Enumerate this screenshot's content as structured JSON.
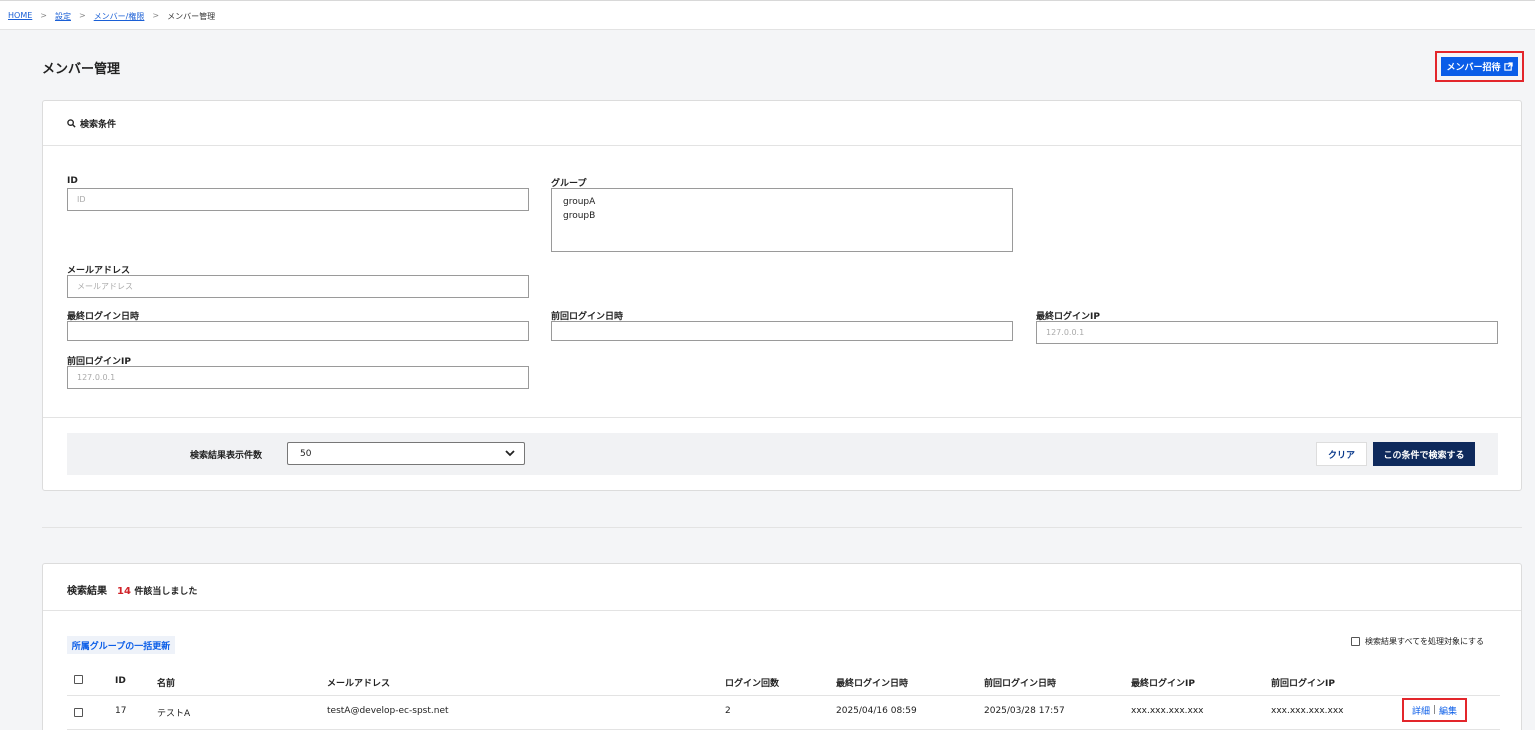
{
  "breadcrumb": {
    "home": "HOME",
    "settings": "設定",
    "members_perm": "メンバー/権限",
    "current": "メンバー管理",
    "sep": ">"
  },
  "page": {
    "title": "メンバー管理",
    "invite_button": "メンバー招待"
  },
  "search": {
    "title": "検索条件",
    "id_label": "ID",
    "id_placeholder": "ID",
    "group_label": "グループ",
    "group_options": [
      "groupA",
      "groupB"
    ],
    "email_label": "メールアドレス",
    "email_placeholder": "メールアドレス",
    "last_login_label": "最終ログイン日時",
    "prev_login_label": "前回ログイン日時",
    "last_ip_label": "最終ログインIP",
    "last_ip_placeholder": "127.0.0.1",
    "prev_ip_label": "前回ログインIP",
    "prev_ip_placeholder": "127.0.0.1",
    "per_page_label": "検索結果表示件数",
    "per_page_value": "50",
    "clear_button": "クリア",
    "submit_button": "この条件で検索する"
  },
  "results": {
    "title": "検索結果",
    "count": "14",
    "count_suffix": "件該当しました",
    "bulk_button": "所属グループの一括更新",
    "select_all_label": "検索結果すべてを処理対象にする",
    "headers": {
      "id": "ID",
      "name": "名前",
      "email": "メールアドレス",
      "login_count": "ログイン回数",
      "last_login": "最終ログイン日時",
      "prev_login": "前回ログイン日時",
      "last_ip": "最終ログインIP",
      "prev_ip": "前回ログインIP"
    },
    "rows": [
      {
        "id": "17",
        "name": "テストA",
        "email": "testA@develop-ec-spst.net",
        "login_count": "2",
        "last_login": "2025/04/16 08:59",
        "prev_login": "2025/03/28 17:57",
        "last_ip": "xxx.xxx.xxx.xxx",
        "prev_ip": "xxx.xxx.xxx.xxx",
        "detail": "詳細",
        "sep": "|",
        "edit": "編集"
      }
    ]
  },
  "colors": {
    "primary": "#0a5de8",
    "navy": "#0f2a5c",
    "highlight": "#e3262b",
    "count": "#d0242a"
  },
  "icons": {
    "search": "search-icon",
    "external": "external-link-icon",
    "chevron": "chevron-down-icon"
  }
}
